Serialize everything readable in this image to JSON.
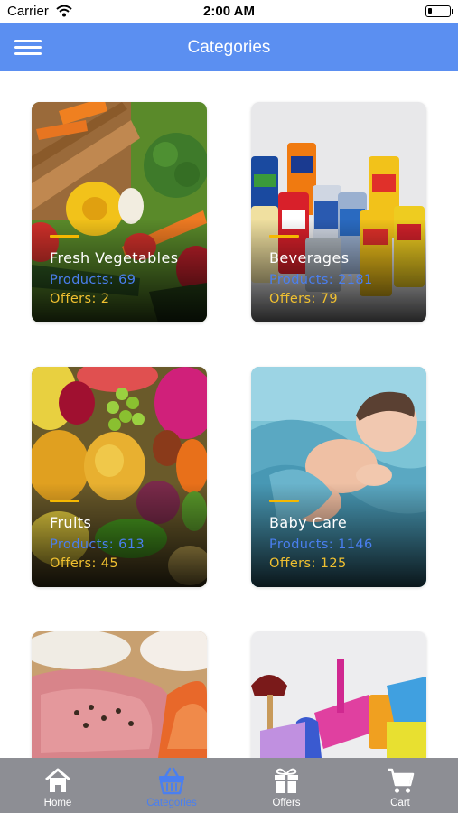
{
  "status_bar": {
    "carrier": "Carrier",
    "time": "2:00 AM"
  },
  "header": {
    "title": "Categories"
  },
  "categories": [
    {
      "name": "Fresh Vegetables",
      "products": "Products: 69",
      "offers": "Offers: 2"
    },
    {
      "name": "Beverages",
      "products": "Products: 2181",
      "offers": "Offers: 79"
    },
    {
      "name": "Fruits",
      "products": "Products: 613",
      "offers": "Offers: 45"
    },
    {
      "name": "Baby Care",
      "products": "Products: 1146",
      "offers": "Offers: 125"
    }
  ],
  "tabs": [
    {
      "label": "Home",
      "icon": "home-icon",
      "active": false
    },
    {
      "label": "Categories",
      "icon": "basket-icon",
      "active": true
    },
    {
      "label": "Offers",
      "icon": "gift-icon",
      "active": false
    },
    {
      "label": "Cart",
      "icon": "cart-icon",
      "active": false
    }
  ],
  "colors": {
    "accent": "#5b8ff1",
    "product_count": "#4a7ff0",
    "offer_count": "#f0c030",
    "tab_bar": "#8d8e94"
  }
}
